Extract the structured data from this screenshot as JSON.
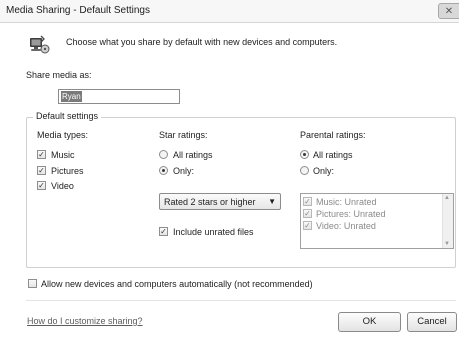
{
  "window": {
    "title": "Media Sharing - Default Settings",
    "close_glyph": "✕"
  },
  "header": {
    "icon": "media-sharing-icon",
    "text": "Choose what you share by default with new devices and computers."
  },
  "share_media": {
    "label": "Share media as:",
    "value": "Ryan"
  },
  "default_settings": {
    "title": "Default settings",
    "media_types": {
      "heading": "Media types:",
      "items": [
        {
          "label": "Music",
          "checked": true
        },
        {
          "label": "Pictures",
          "checked": true
        },
        {
          "label": "Video",
          "checked": true
        }
      ]
    },
    "star_ratings": {
      "heading": "Star ratings:",
      "all_label": "All ratings",
      "only_label": "Only:",
      "selected": "only",
      "dropdown_value": "Rated 2 stars or higher",
      "include_unrated_label": "Include unrated files",
      "include_unrated_checked": true
    },
    "parental_ratings": {
      "heading": "Parental ratings:",
      "all_label": "All ratings",
      "only_label": "Only:",
      "selected": "all",
      "list_items": [
        {
          "label": "Music: Unrated",
          "checked": true
        },
        {
          "label": "Pictures: Unrated",
          "checked": true
        },
        {
          "label": "Video: Unrated",
          "checked": true
        }
      ]
    }
  },
  "allow_new_devices": {
    "label": "Allow new devices and computers automatically (not recommended)",
    "checked": false
  },
  "footer": {
    "help_link": "How do I customize sharing?",
    "ok_label": "OK",
    "cancel_label": "Cancel"
  },
  "glyphs": {
    "check": "✓",
    "dropdown_arrow": "▼",
    "scroll_up": "▲",
    "scroll_down": "▼"
  }
}
